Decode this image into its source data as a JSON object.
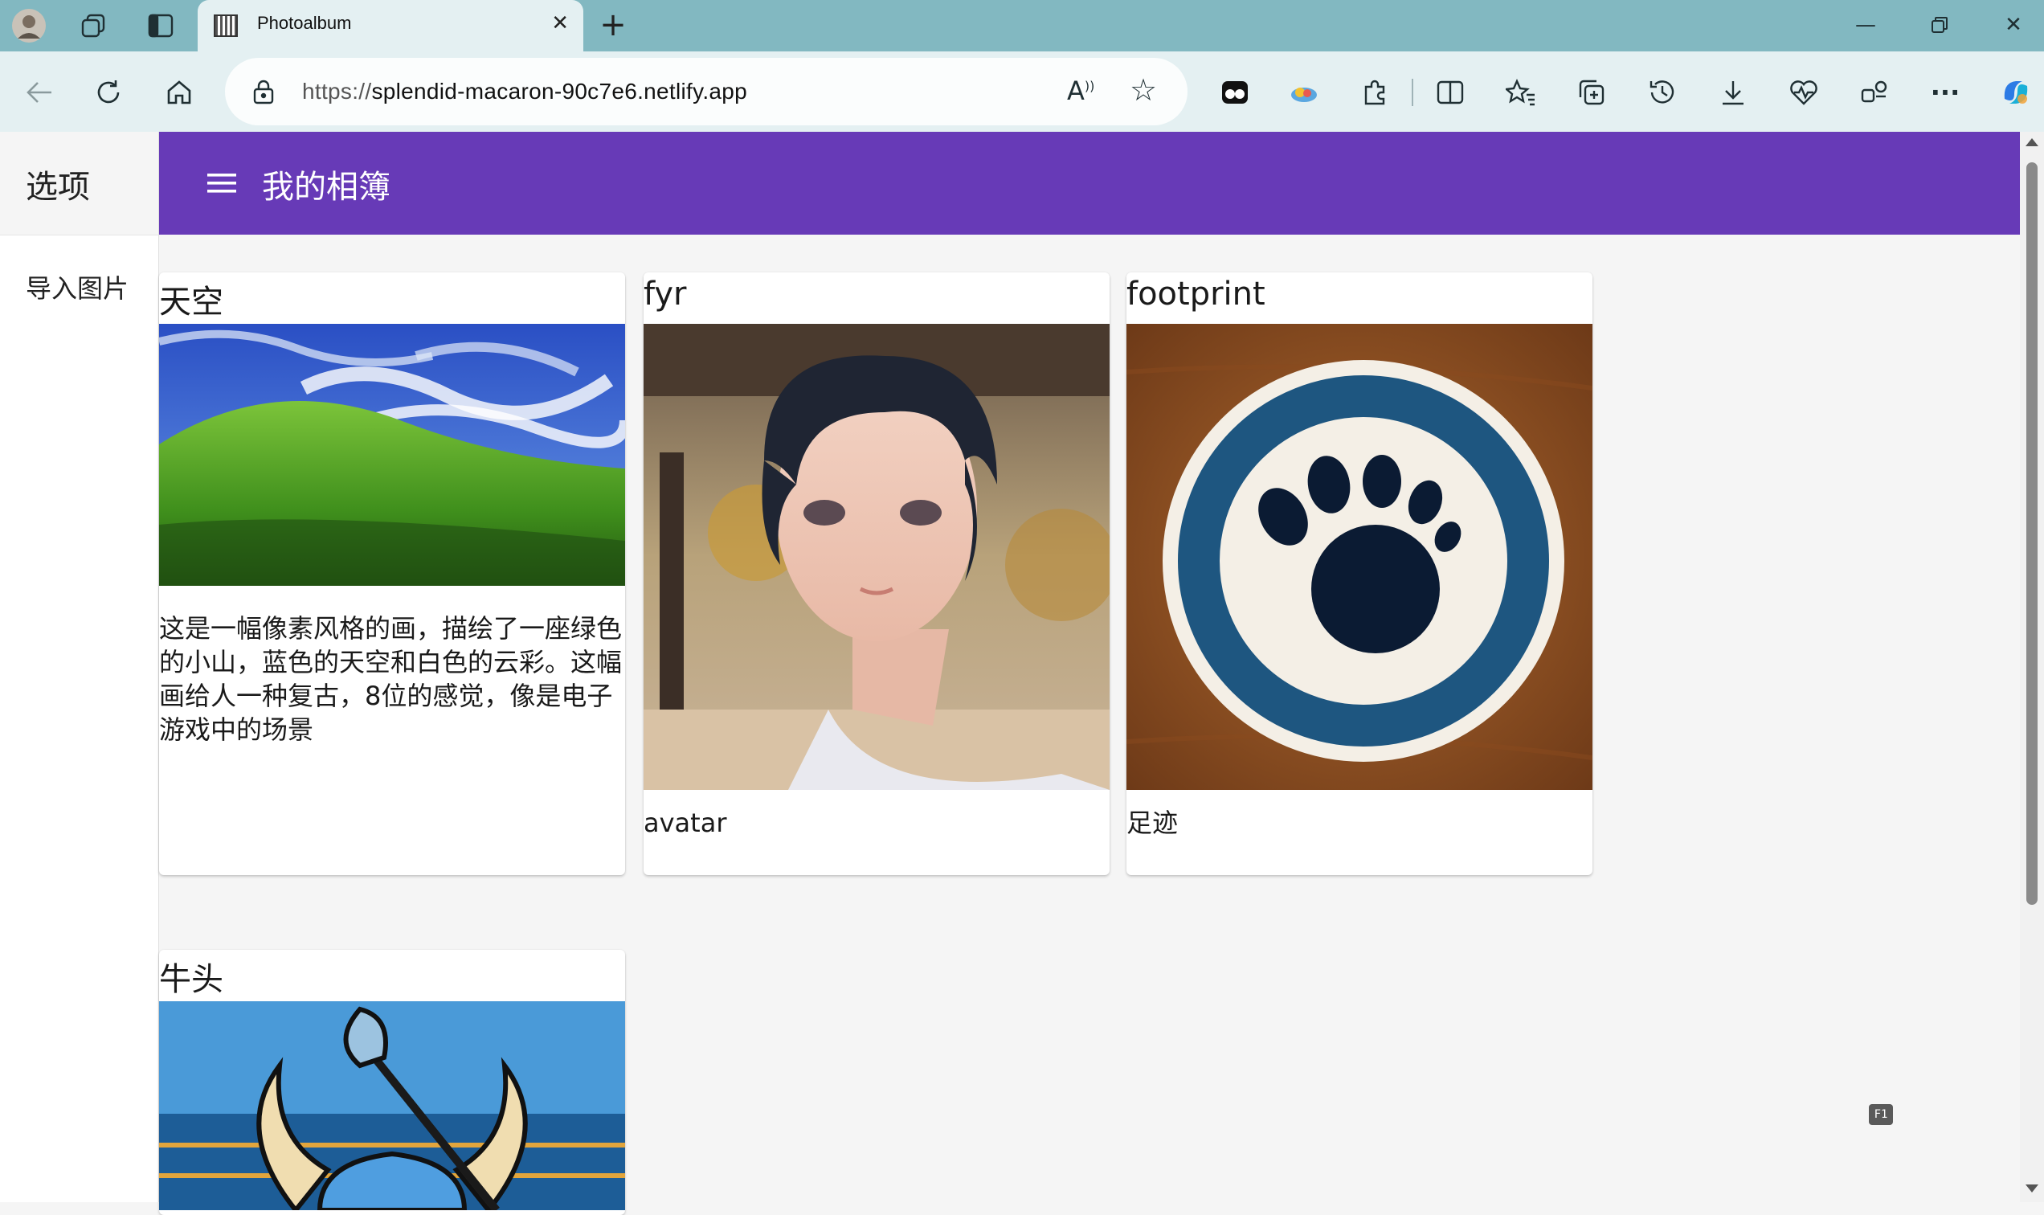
{
  "browser": {
    "tab_title": "Photoalbum",
    "url_protocol": "https://",
    "url_host": "splendid-macaron-90c7e6.netlify.app",
    "reader_icon_label": "A",
    "accent": "#82b8c1"
  },
  "drawer": {
    "title": "选项",
    "items": [
      {
        "label": "导入图片"
      }
    ]
  },
  "appbar": {
    "title": "我的相簿",
    "color": "#673ab7"
  },
  "cards": [
    {
      "title": "天空",
      "image": "pixel-art-green-hill-blue-sky",
      "description": "这是一幅像素风格的画，描绘了一座绿色的小山，蓝色的天空和白色的云彩。这幅画给人一种复古，8位的感觉，像是电子游戏中的场景"
    },
    {
      "title": "fyr",
      "image": "anime-boy-portrait",
      "description": "avatar"
    },
    {
      "title": "footprint",
      "image": "paw-print-coaster",
      "description": "足迹"
    },
    {
      "title": "牛头",
      "image": "horned-helmet-knight-with-shovel",
      "description": ""
    }
  ],
  "overlay": {
    "f1_badge": "F1"
  }
}
